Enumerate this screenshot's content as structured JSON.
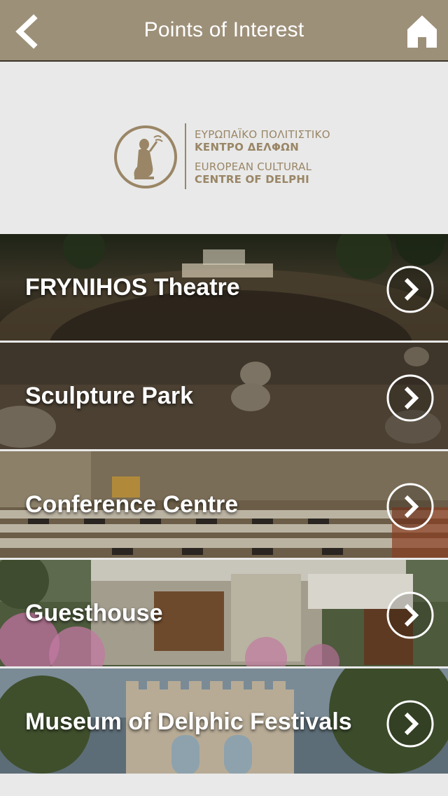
{
  "header": {
    "title": "Points of Interest",
    "back_icon": "chevron-left-icon",
    "home_icon": "home-icon",
    "bar_color": "#9d9079"
  },
  "logo": {
    "line1": "ΕΥΡΩΠΑΪΚΟ ΠΟΛΙΤΙΣΤΙΚΟ",
    "line2": "ΚΕΝΤΡΟ ΔΕΛΦΩΝ",
    "line3": "EUROPEAN CULTURAL",
    "line4": "CENTRE OF DELPHI",
    "color": "#9a8666"
  },
  "items": [
    {
      "label": "FRYNIHOS Theatre",
      "icon": "chevron-right-circle-icon"
    },
    {
      "label": "Sculpture Park",
      "icon": "chevron-right-circle-icon"
    },
    {
      "label": "Conference Centre",
      "icon": "chevron-right-circle-icon"
    },
    {
      "label": "Guesthouse",
      "icon": "chevron-right-circle-icon"
    },
    {
      "label": "Museum of Delphic Festivals",
      "icon": "chevron-right-circle-icon"
    }
  ]
}
